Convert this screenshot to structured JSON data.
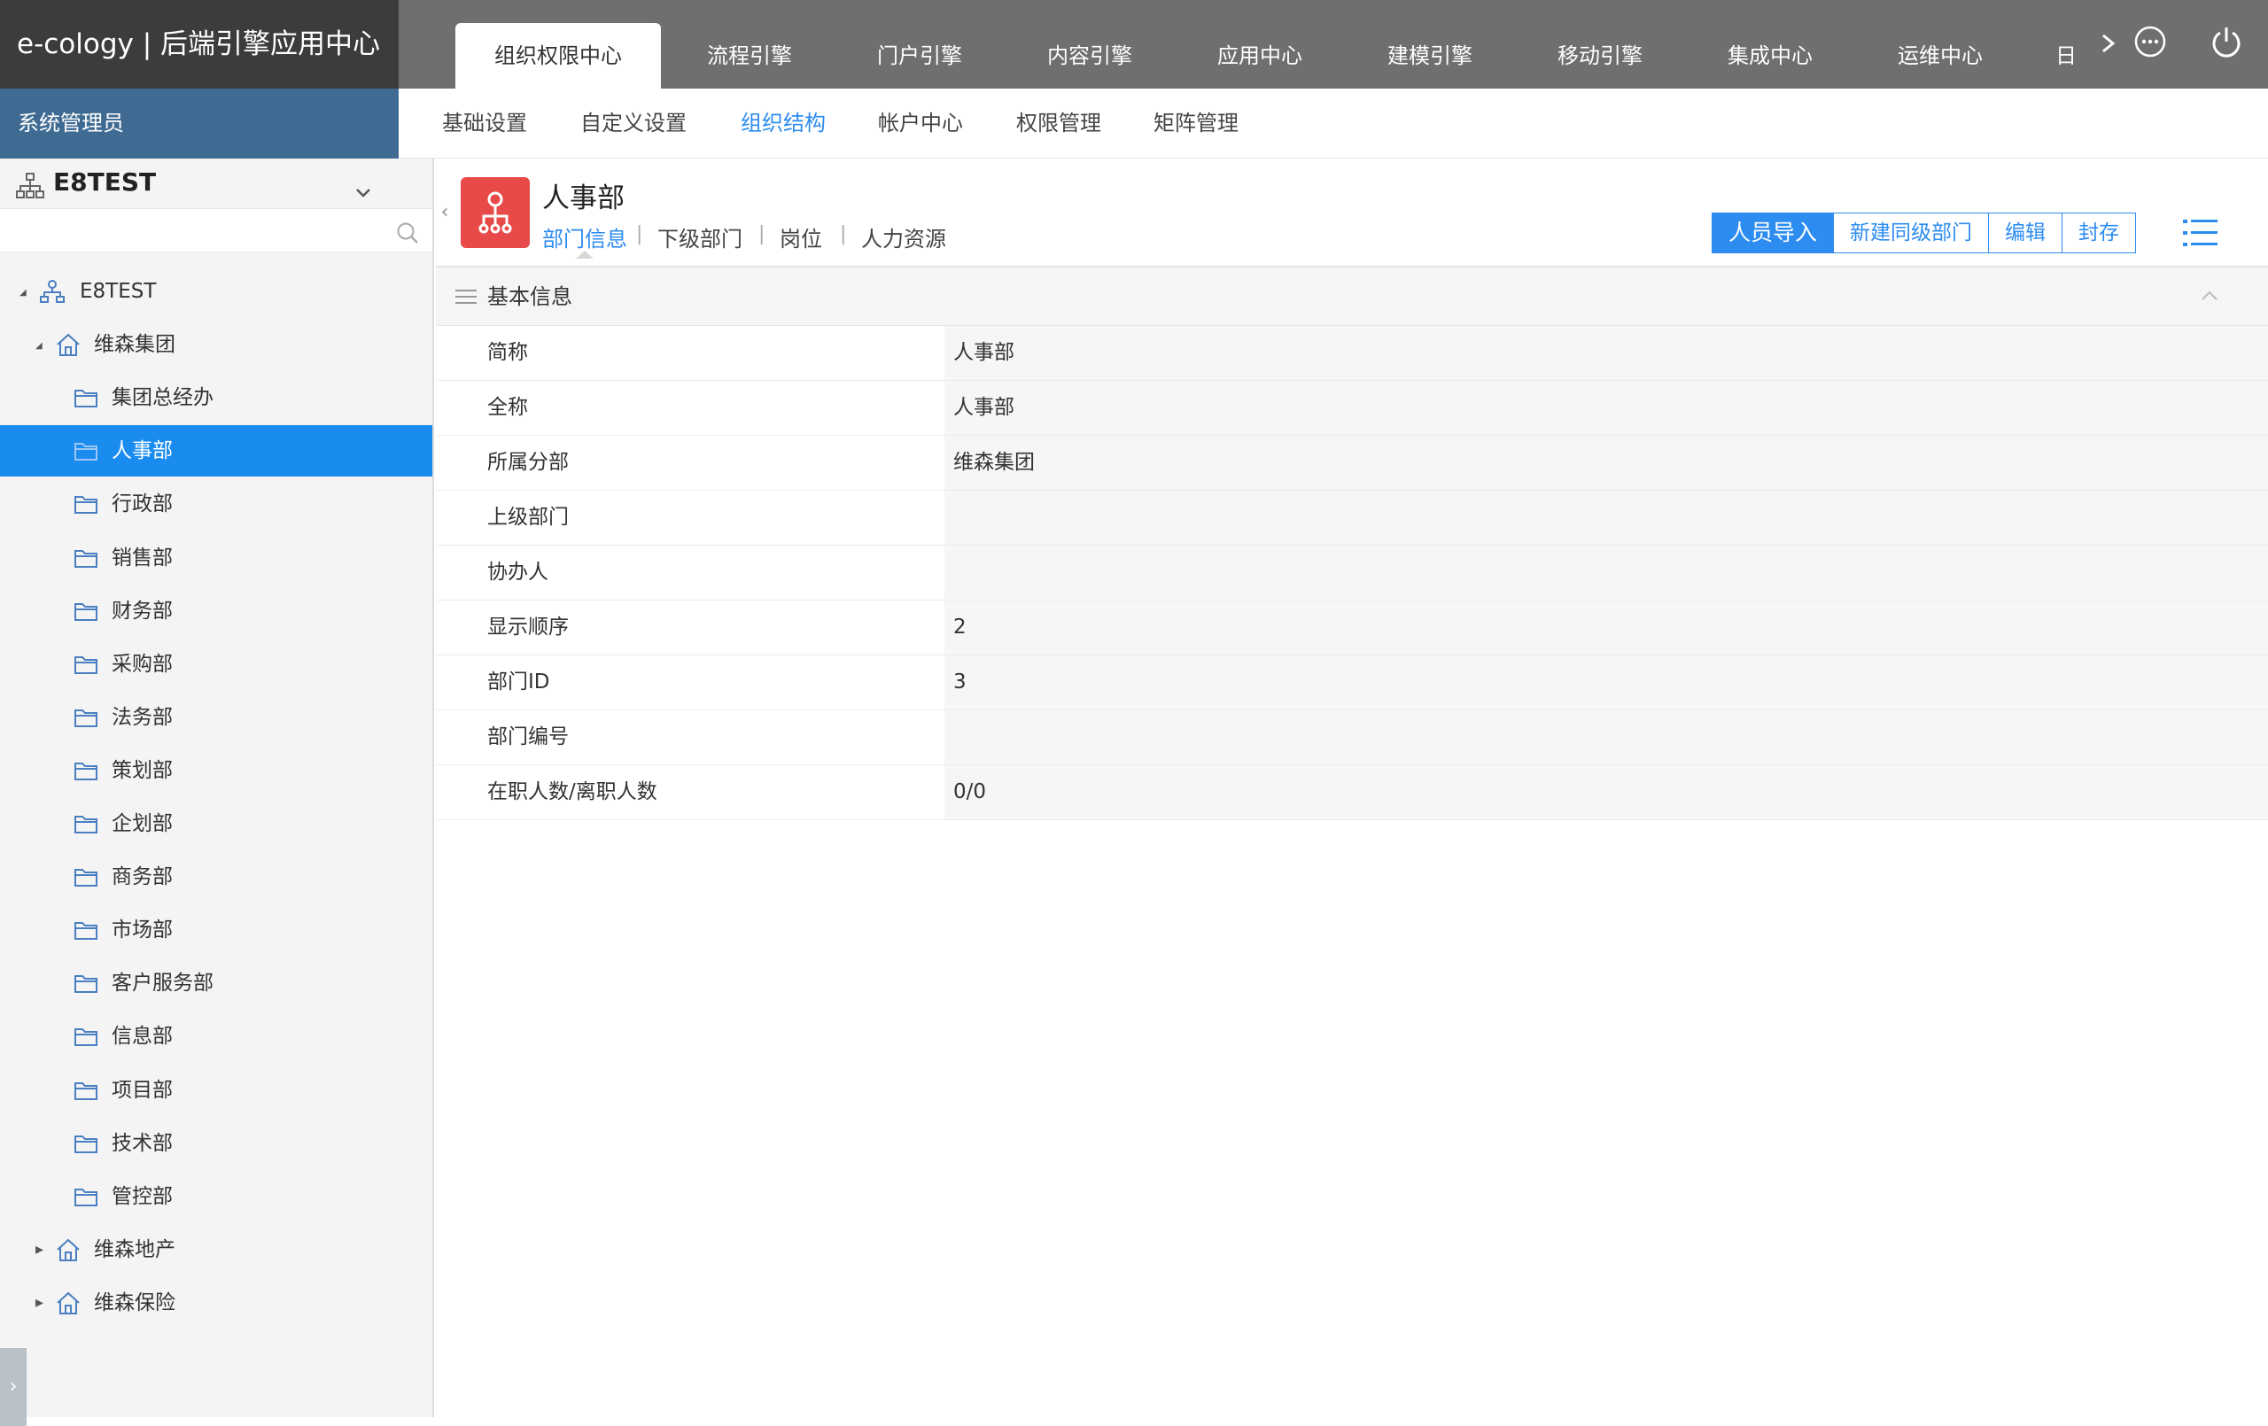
{
  "brand": {
    "title": "e-cology | 后端引擎应用中心"
  },
  "main_tabs": [
    {
      "label": "组织权限中心",
      "active": true
    },
    {
      "label": "流程引擎"
    },
    {
      "label": "门户引擎"
    },
    {
      "label": "内容引擎"
    },
    {
      "label": "应用中心"
    },
    {
      "label": "建模引擎"
    },
    {
      "label": "移动引擎"
    },
    {
      "label": "集成中心"
    },
    {
      "label": "运维中心"
    },
    {
      "label": "日"
    }
  ],
  "top_icons": {
    "more": "more-dots-icon",
    "power": "power-icon",
    "next": "chevron-right-icon"
  },
  "user_bar": {
    "role": "系统管理员"
  },
  "sub_tabs": [
    {
      "label": "基础设置"
    },
    {
      "label": "自定义设置"
    },
    {
      "label": "组织结构",
      "active": true
    },
    {
      "label": "帐户中心"
    },
    {
      "label": "权限管理"
    },
    {
      "label": "矩阵管理"
    }
  ],
  "sidebar": {
    "company": "E8TEST",
    "search_placeholder": "",
    "tree": [
      {
        "label": "E8TEST",
        "level": 0,
        "type": "org",
        "expanded": true
      },
      {
        "label": "维森集团",
        "level": 1,
        "type": "subcompany",
        "expanded": true
      },
      {
        "label": "集团总经办",
        "level": 2,
        "type": "dept"
      },
      {
        "label": "人事部",
        "level": 2,
        "type": "dept",
        "selected": true
      },
      {
        "label": "行政部",
        "level": 2,
        "type": "dept"
      },
      {
        "label": "销售部",
        "level": 2,
        "type": "dept"
      },
      {
        "label": "财务部",
        "level": 2,
        "type": "dept"
      },
      {
        "label": "采购部",
        "level": 2,
        "type": "dept"
      },
      {
        "label": "法务部",
        "level": 2,
        "type": "dept"
      },
      {
        "label": "策划部",
        "level": 2,
        "type": "dept"
      },
      {
        "label": "企划部",
        "level": 2,
        "type": "dept"
      },
      {
        "label": "商务部",
        "level": 2,
        "type": "dept"
      },
      {
        "label": "市场部",
        "level": 2,
        "type": "dept"
      },
      {
        "label": "客户服务部",
        "level": 2,
        "type": "dept"
      },
      {
        "label": "信息部",
        "level": 2,
        "type": "dept"
      },
      {
        "label": "项目部",
        "level": 2,
        "type": "dept"
      },
      {
        "label": "技术部",
        "level": 2,
        "type": "dept"
      },
      {
        "label": "管控部",
        "level": 2,
        "type": "dept"
      },
      {
        "label": "维森地产",
        "level": 1,
        "type": "subcompany",
        "expanded": false
      },
      {
        "label": "维森保险",
        "level": 1,
        "type": "subcompany",
        "expanded": false
      }
    ]
  },
  "department": {
    "name": "人事部",
    "tabs": [
      {
        "label": "部门信息",
        "active": true
      },
      {
        "label": "下级部门"
      },
      {
        "label": "岗位"
      },
      {
        "label": "人力资源"
      }
    ],
    "actions": {
      "import": "人员导入",
      "new_sibling": "新建同级部门",
      "edit": "编辑",
      "archive": "封存"
    }
  },
  "basic_info": {
    "title": "基本信息",
    "rows": [
      {
        "label": "简称",
        "value": "人事部"
      },
      {
        "label": "全称",
        "value": "人事部"
      },
      {
        "label": "所属分部",
        "value": "维森集团"
      },
      {
        "label": "上级部门",
        "value": ""
      },
      {
        "label": "协办人",
        "value": ""
      },
      {
        "label": "显示顺序",
        "value": "2"
      },
      {
        "label": "部门ID",
        "value": "3"
      },
      {
        "label": "部门编号",
        "value": ""
      },
      {
        "label": "在职人数/离职人数",
        "value": "0/0"
      }
    ]
  },
  "colors": {
    "accent": "#2d8cf0",
    "selected_node": "#1a8cf0",
    "user_bar": "#3f6b93",
    "topbar": "#6f6f6f",
    "brand_bg": "#3c3c3c",
    "dept_icon": "#e84a4a"
  }
}
